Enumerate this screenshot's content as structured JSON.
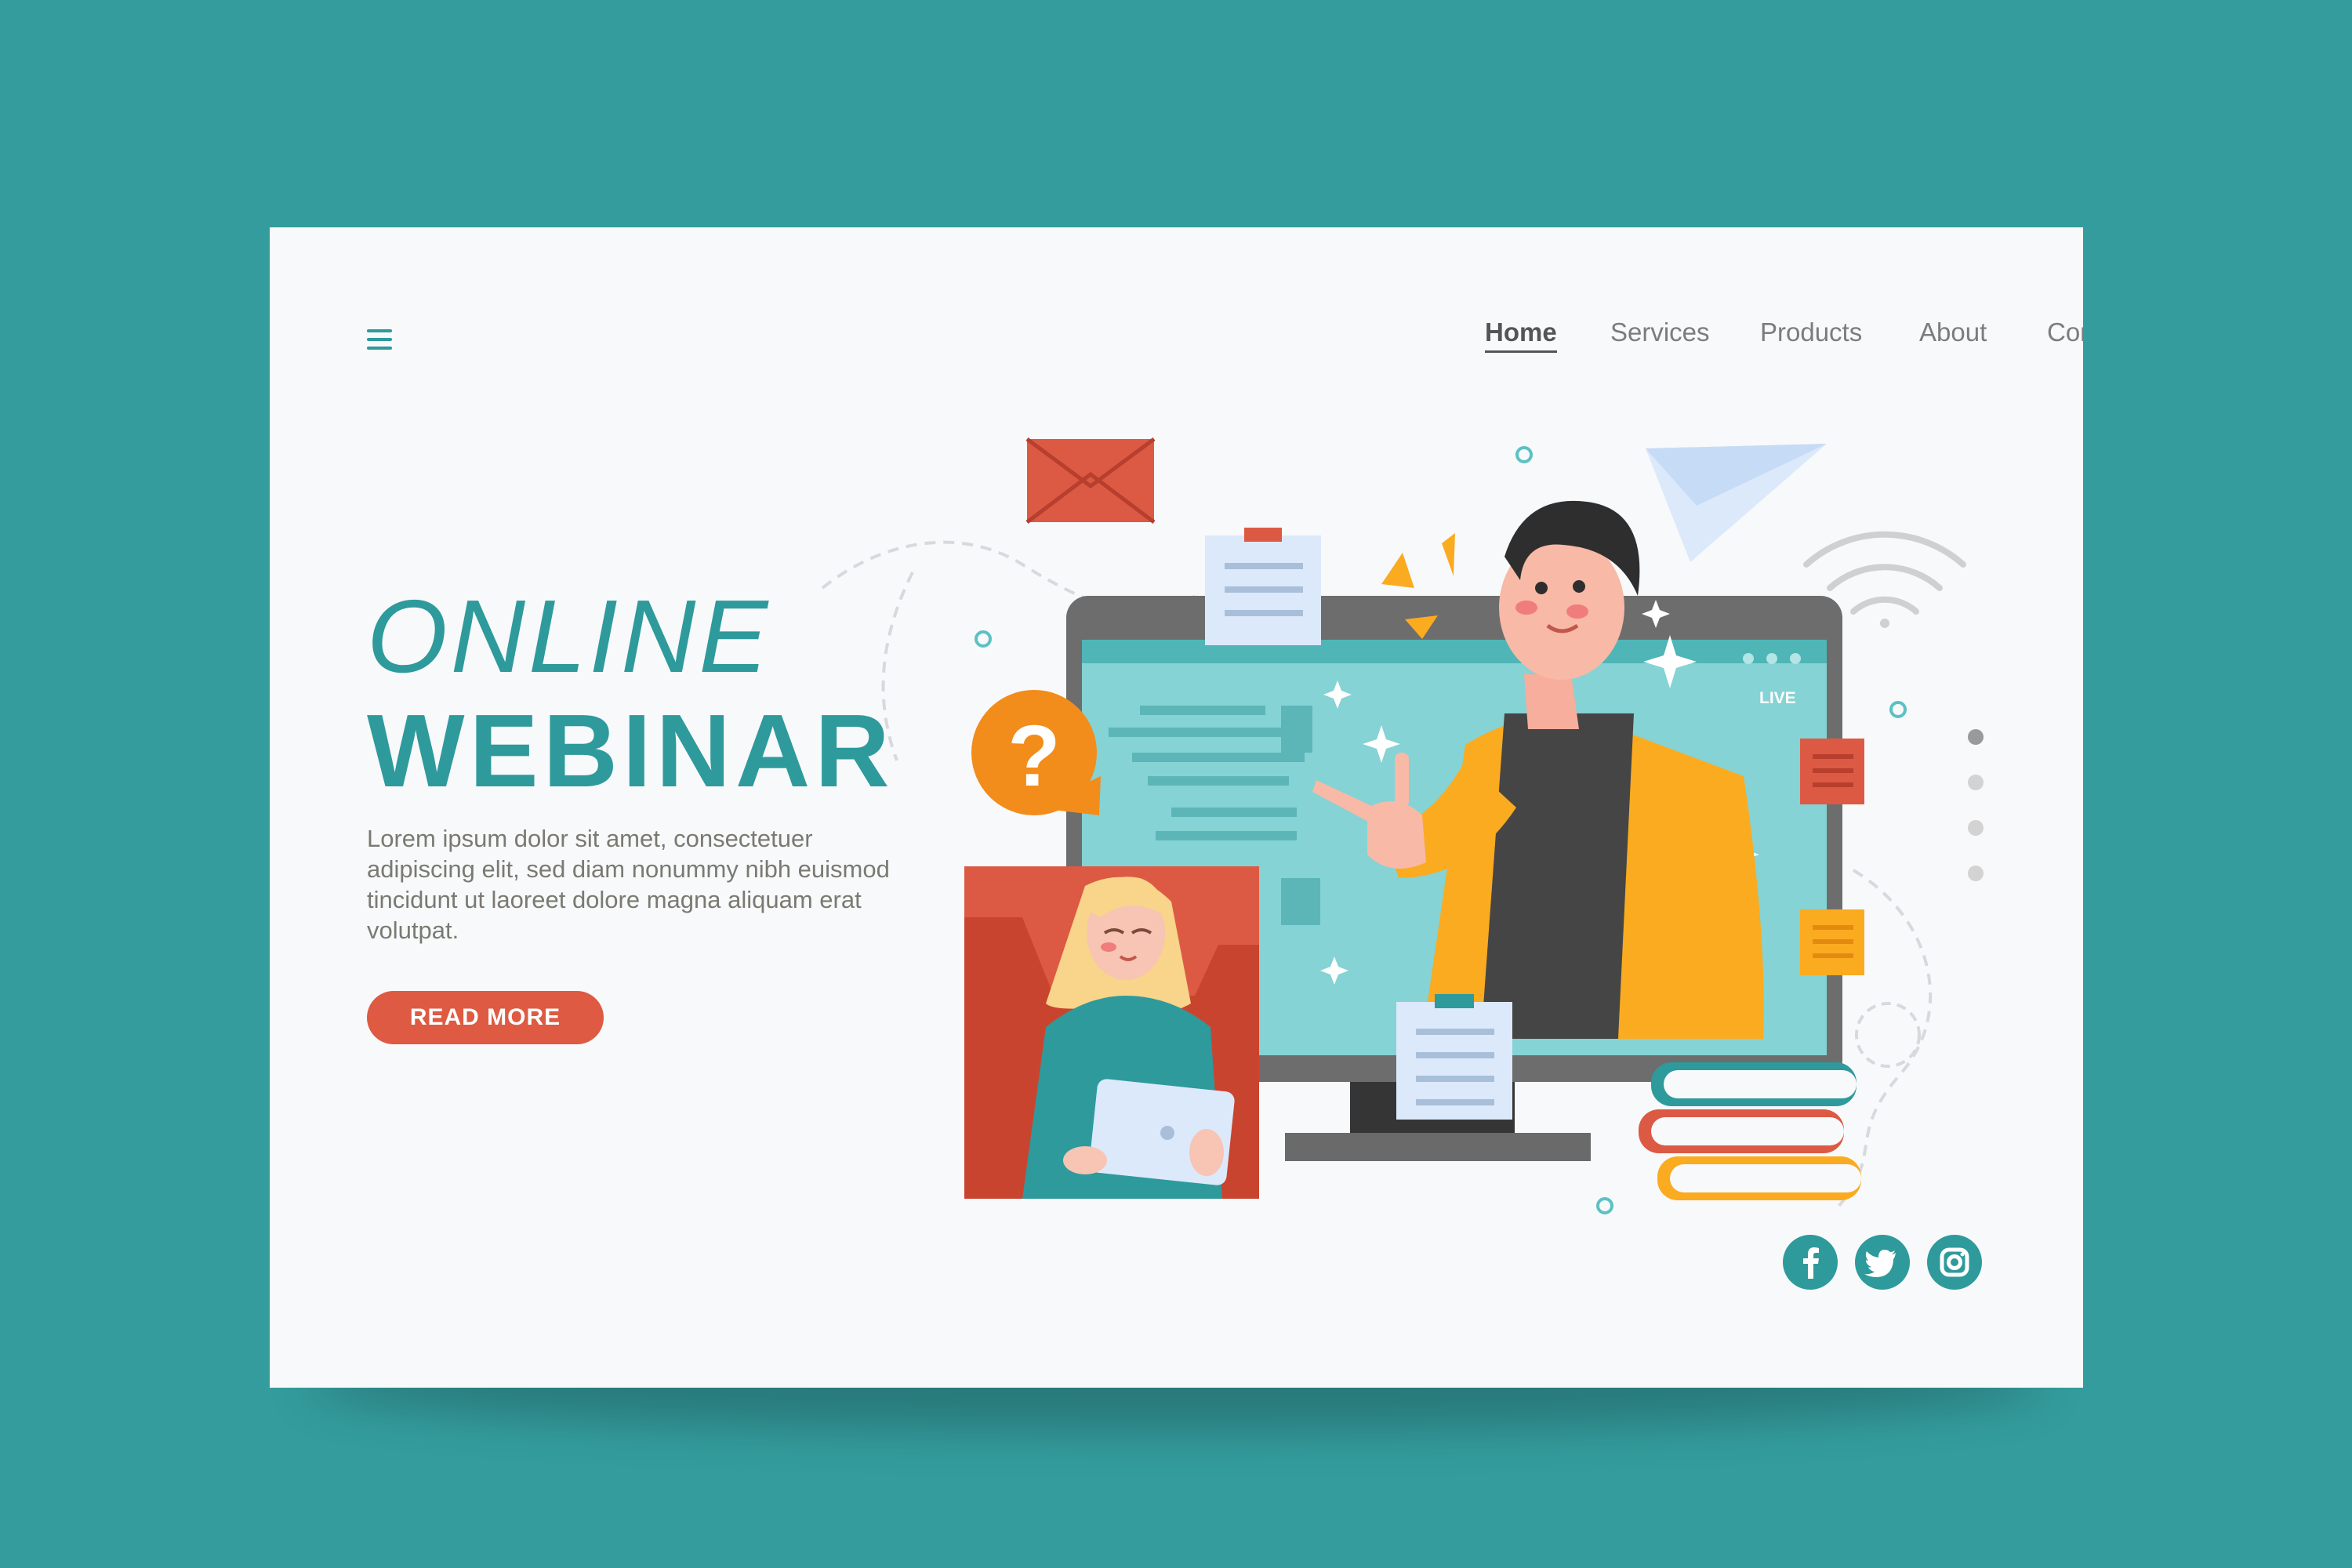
{
  "nav": {
    "items": [
      {
        "label": "Home",
        "active": true
      },
      {
        "label": "Services",
        "active": false
      },
      {
        "label": "Products",
        "active": false
      },
      {
        "label": "About",
        "active": false
      },
      {
        "label": "Contact",
        "active": false
      }
    ]
  },
  "hero": {
    "title_line1": "ONLINE",
    "title_line2": "WEBINAR",
    "description": "Lorem ipsum dolor sit amet, consectetuer adipiscing elit, sed diam nonummy nibh euismod tincidunt ut laoreet dolore magna aliquam erat volutpat.",
    "button_label": "READ MORE"
  },
  "illustration": {
    "live_label": "LIVE",
    "question_mark": "?"
  },
  "slider": {
    "count": 4,
    "active_index": 0
  },
  "social": [
    "facebook-icon",
    "twitter-icon",
    "instagram-icon"
  ],
  "colors": {
    "background": "#349c9d",
    "card": "#f8f9fb",
    "accent_teal": "#2e9a9c",
    "accent_red": "#de5a42",
    "accent_orange": "#f39a1e",
    "accent_yellow": "#fbab20"
  }
}
